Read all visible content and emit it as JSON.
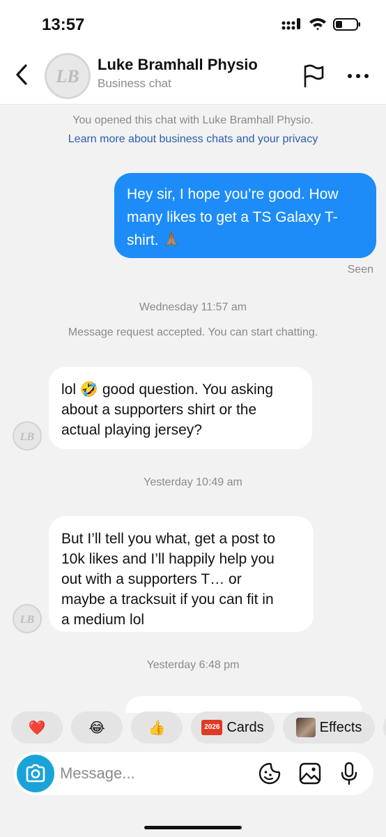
{
  "status": {
    "time": "13:57"
  },
  "header": {
    "avatar_initials": "LB",
    "title": "Luke Bramhall Physio",
    "subtitle": "Business chat"
  },
  "system": {
    "opened": "You opened this chat with Luke Bramhall Physio.",
    "learn_more": "Learn more about business chats and your privacy",
    "accepted": "Message request accepted. You can start chatting."
  },
  "messages": {
    "out1": {
      "lines": [
        "Hey sir, I hope you’re good. How",
        "many likes to get a TS Galaxy T-",
        "shirt. 🙏🏽"
      ],
      "status": "Seen"
    },
    "stamp1": "Wednesday 11:57 am",
    "in1": {
      "lines": [
        "lol 🤣 good question. You asking",
        "about a supporters shirt or the",
        "actual playing jersey?"
      ]
    },
    "stamp2": "Yesterday 10:49 am",
    "in2": {
      "lines": [
        "But I’ll tell you what, get a post to",
        "10k likes and I’ll happily help you",
        "out with a supporters T… or",
        "maybe a tracksuit if you can fit in",
        "a medium lol"
      ]
    },
    "stamp3": "Yesterday 6:48 pm"
  },
  "quick": {
    "heart": "❤️",
    "laugh": "😂",
    "thumbs": "👍",
    "cards_badge": "2026",
    "cards": "Cards",
    "effects": "Effects"
  },
  "composer": {
    "placeholder": "Message..."
  },
  "colors": {
    "accent": "#1d8cf8",
    "camera": "#1aa3d9",
    "link": "#2a5db0",
    "background": "#f2f2f2"
  }
}
